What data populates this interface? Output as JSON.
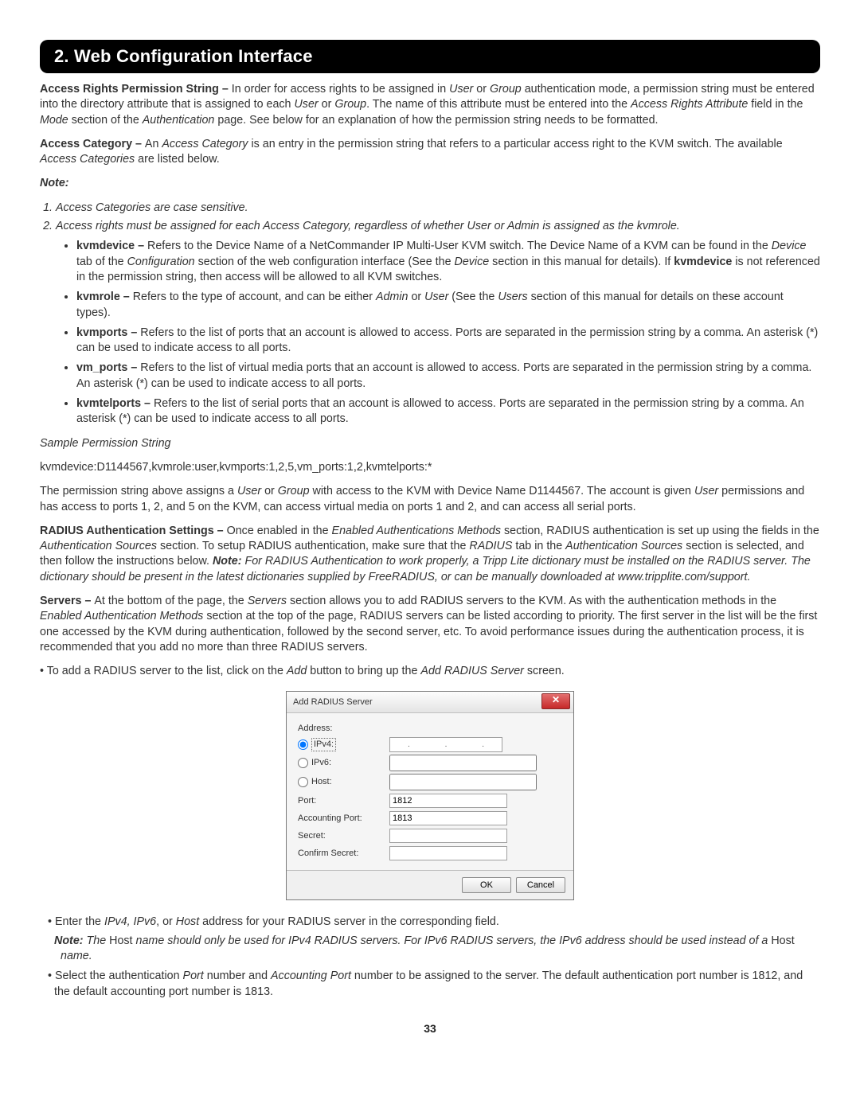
{
  "header": {
    "title": "2. Web Configuration Interface"
  },
  "p1": {
    "label": "Access Rights Permission String – ",
    "t1": "In order for access rights to be assigned in ",
    "i1": "User",
    "t2": " or ",
    "i2": "Group",
    "t3": " authentication mode, a permission string must be entered into the directory attribute that is assigned to each ",
    "i3": "User",
    "t4": " or ",
    "i4": "Group",
    "t5": ". The name of this attribute must be entered into the ",
    "i5": "Access Rights Attribute",
    "t6": " field in the ",
    "i6": "Mode",
    "t7": " section of the ",
    "i7": "Authentication",
    "t8": " page. See below for an explanation of how the permission string needs to be formatted."
  },
  "p2": {
    "label": "Access Category – ",
    "t1": "An ",
    "i1": "Access Category",
    "t2": " is an entry in the permission string that refers to a particular access right to the KVM switch. The available ",
    "i2": "Access Categories",
    "t3": " are listed below."
  },
  "noteHeading": "Note:",
  "ol": {
    "n1": "Access Categories are case sensitive.",
    "n2": "Access rights must be assigned for each Access Category, regardless of whether User or Admin is assigned as the kvmrole."
  },
  "bul": {
    "b1": {
      "lab": "kvmdevice – ",
      "t1": "Refers to the Device Name of a NetCommander IP Multi-User KVM switch. The Device Name of a KVM can be found in the ",
      "i1": "Device",
      "t2": " tab of the ",
      "i2": "Configuration",
      "t3": " section of the web configuration interface (See the ",
      "i3": "Device",
      "t4": " section in this manual for details). If ",
      "lab2": "kvmdevice",
      "t5": " is not referenced in the permission string, then access will be allowed to all KVM switches."
    },
    "b2": {
      "lab": "kvmrole – ",
      "t1": "Refers to the type of account, and can be either ",
      "i1": "Admin",
      "t2": " or ",
      "i2": "User",
      "t3": " (See the ",
      "i3": "Users",
      "t4": " section of this manual for details on these account types)."
    },
    "b3": {
      "lab": "kvmports – ",
      "t1": "Refers to the list of ports that an account is allowed to access. Ports are separated in the permission string by a comma. An asterisk (*) can be used to indicate access to all ports."
    },
    "b4": {
      "lab": "vm_ports – ",
      "t1": "Refers to the list of virtual media ports that an account is allowed to access. Ports are separated in the permission string by a comma. An asterisk (*) can be used to indicate access to all ports."
    },
    "b5": {
      "lab": "kvmtelports – ",
      "t1": "Refers to the list of serial ports that an account is allowed to access. Ports are separated in the permission string by a comma. An asterisk (*) can be used to indicate access to all ports."
    }
  },
  "sampleHeading": "Sample Permission String",
  "sampleString": "kvmdevice:D1144567,kvmrole:user,kvmports:1,2,5,vm_ports:1,2,kvmtelports:*",
  "p3": {
    "t1": "The permission string above assigns a ",
    "i1": "User",
    "t2": " or ",
    "i2": "Group",
    "t3": " with access to the KVM with Device Name D1144567. The account is given ",
    "i3": "User",
    "t4": " permissions and has access to ports 1, 2, and 5 on the KVM, can access virtual media on ports 1 and 2, and can access all serial ports."
  },
  "p4": {
    "label": "RADIUS Authentication Settings – ",
    "t1": "Once enabled in the ",
    "i1": "Enabled Authentications Methods",
    "t2": " section, RADIUS authentication is set up using the fields in the ",
    "i2": "Authentication Sources",
    "t3": " section. To setup RADIUS authentication, make sure that the ",
    "i3": "RADIUS",
    "t4": " tab in the ",
    "i4": "Authentication Sources",
    "t5": " section is selected, and then follow the instructions below. ",
    "noteLab": "Note:",
    "noteText": " For RADIUS Authentication to work properly, a Tripp Lite dictionary must be installed on the RADIUS server. The dictionary should be present in the latest dictionaries supplied by FreeRADIUS, or can be manually downloaded at www.tripplite.com/support."
  },
  "p5": {
    "label": "Servers – ",
    "t1": "At the bottom of the page, the ",
    "i1": "Servers",
    "t2": " section allows you to add RADIUS servers to the KVM. As with the authentication methods in the ",
    "i2": "Enabled Authentication Methods",
    "t3": " section at the top of the page, RADIUS servers can be listed according to priority. The first server in the list will be the first one accessed by the KVM during authentication, followed by the second server, etc. To avoid performance issues during the authentication process, it is recommended that you add no more than three RADIUS servers."
  },
  "p6": {
    "pre": "• To add a RADIUS server to the list, click on the ",
    "i1": "Add",
    "mid": " button to bring up the ",
    "i2": "Add RADIUS Server",
    "post": " screen."
  },
  "dialog": {
    "title": "Add RADIUS Server",
    "addressLabel": "Address:",
    "ipv4": "IPv4:",
    "ipv6": "IPv6:",
    "host": "Host:",
    "port": "Port:",
    "portVal": "1812",
    "acctPort": "Accounting Port:",
    "acctVal": "1813",
    "secret": "Secret:",
    "confirm": "Confirm Secret:",
    "ok": "OK",
    "cancel": "Cancel",
    "dot": "."
  },
  "p7": {
    "pre": "• Enter the ",
    "i1": "IPv4, IPv6",
    "mid": ", or ",
    "i2": "Host",
    "post": " address for your RADIUS server in the corresponding field."
  },
  "p7note": {
    "lab": "Note:",
    "t1": " The ",
    "h1": "Host",
    "t2": " name should only be used for IPv4 RADIUS servers. For IPv6 RADIUS servers, the IPv6 address should be used instead of a ",
    "h2": "Host",
    "t3": " name."
  },
  "p8": {
    "pre": "• Select the authentication ",
    "i1": "Port",
    "mid": " number and ",
    "i2": "Accounting Port",
    "post": " number to be assigned to the server. The default authentication port number is 1812, and the default accounting port number is 1813."
  },
  "pageNumber": "33"
}
